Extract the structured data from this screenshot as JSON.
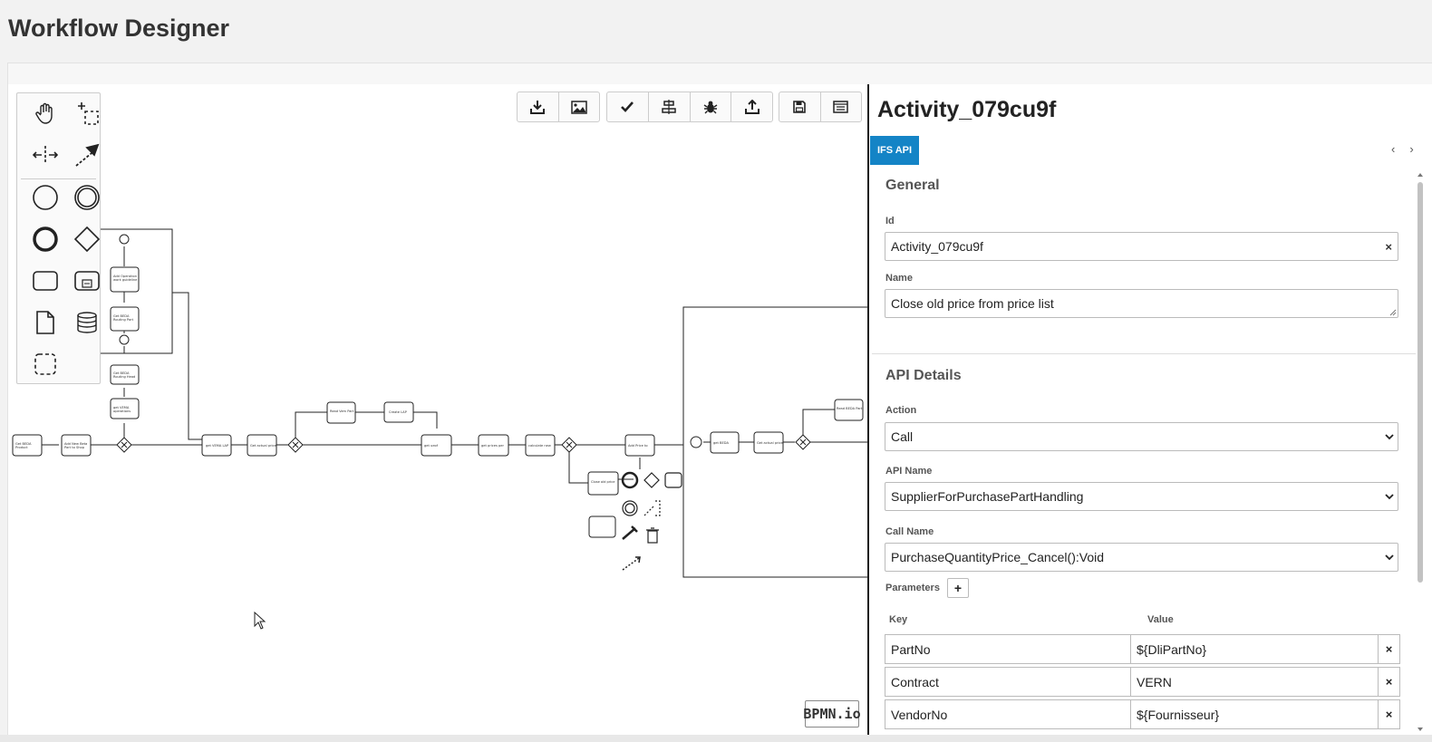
{
  "page": {
    "title": "Workflow Designer"
  },
  "palette": {
    "tools": [
      {
        "name": "hand-tool",
        "icon": "hand-icon"
      },
      {
        "name": "lasso-tool",
        "icon": "lasso-icon"
      },
      {
        "name": "space-tool",
        "icon": "space-icon"
      },
      {
        "name": "global-connect-tool",
        "icon": "connect-icon"
      },
      {
        "name": "start-event",
        "icon": "circle-icon"
      },
      {
        "name": "intermediate-event",
        "icon": "double-circle-icon"
      },
      {
        "name": "end-event",
        "icon": "bold-circle-icon"
      },
      {
        "name": "gateway",
        "icon": "diamond-icon"
      },
      {
        "name": "task",
        "icon": "rounded-rect-icon"
      },
      {
        "name": "subprocess",
        "icon": "subprocess-icon"
      },
      {
        "name": "data-object",
        "icon": "document-icon"
      },
      {
        "name": "data-store",
        "icon": "database-icon"
      },
      {
        "name": "group",
        "icon": "dashed-rect-icon"
      }
    ]
  },
  "toolbar": {
    "buttons": [
      {
        "name": "download-button",
        "icon": "download-icon"
      },
      {
        "name": "export-image-button",
        "icon": "image-icon"
      },
      {
        "name": "validate-button",
        "icon": "check-icon"
      },
      {
        "name": "align-button",
        "icon": "align-icon"
      },
      {
        "name": "debug-button",
        "icon": "bug-icon"
      },
      {
        "name": "deploy-button",
        "icon": "upload-icon"
      },
      {
        "name": "save-button",
        "icon": "floppy-icon"
      },
      {
        "name": "properties-toggle-button",
        "icon": "panel-icon"
      }
    ]
  },
  "diagram": {
    "tasks": [
      "Get BEDA Product Structure",
      "Add New Beta Part to Shop Ord Material",
      "get VEMA operations workguidelines",
      "Get BEDA Routing Head",
      "Get BEDA Routing Part Operations",
      "Add Operation work guideline to beta routing",
      "get VEMA LAP",
      "Get actual price",
      "Read Vem Part (Purchase Part)",
      "Create LAP",
      "get ueof ergonomie",
      "get prices per loan per operation",
      "calculate new price",
      "Add Price to Price List",
      "Close old price from price list",
      "get BEDA Material LAP",
      "Get actual price",
      "Read BEDA Part (Purchase Part)"
    ],
    "logo": "BPMN.io"
  },
  "panel": {
    "title": "Activity_079cu9f",
    "tab": "IFS API",
    "general": {
      "heading": "General",
      "id_label": "Id",
      "id_value": "Activity_079cu9f",
      "name_label": "Name",
      "name_value": "Close old price from price list"
    },
    "api": {
      "heading": "API Details",
      "action_label": "Action",
      "action_value": "Call",
      "api_name_label": "API Name",
      "api_name_value": "SupplierForPurchasePartHandling",
      "call_name_label": "Call Name",
      "call_name_value": "PurchaseQuantityPrice_Cancel():Void",
      "parameters_label": "Parameters",
      "add_label": "+",
      "key_header": "Key",
      "value_header": "Value",
      "parameters": [
        {
          "key": "PartNo",
          "value": "${DliPartNo}"
        },
        {
          "key": "Contract",
          "value": "VERN"
        },
        {
          "key": "VendorNo",
          "value": "${Fournisseur}"
        }
      ]
    }
  }
}
